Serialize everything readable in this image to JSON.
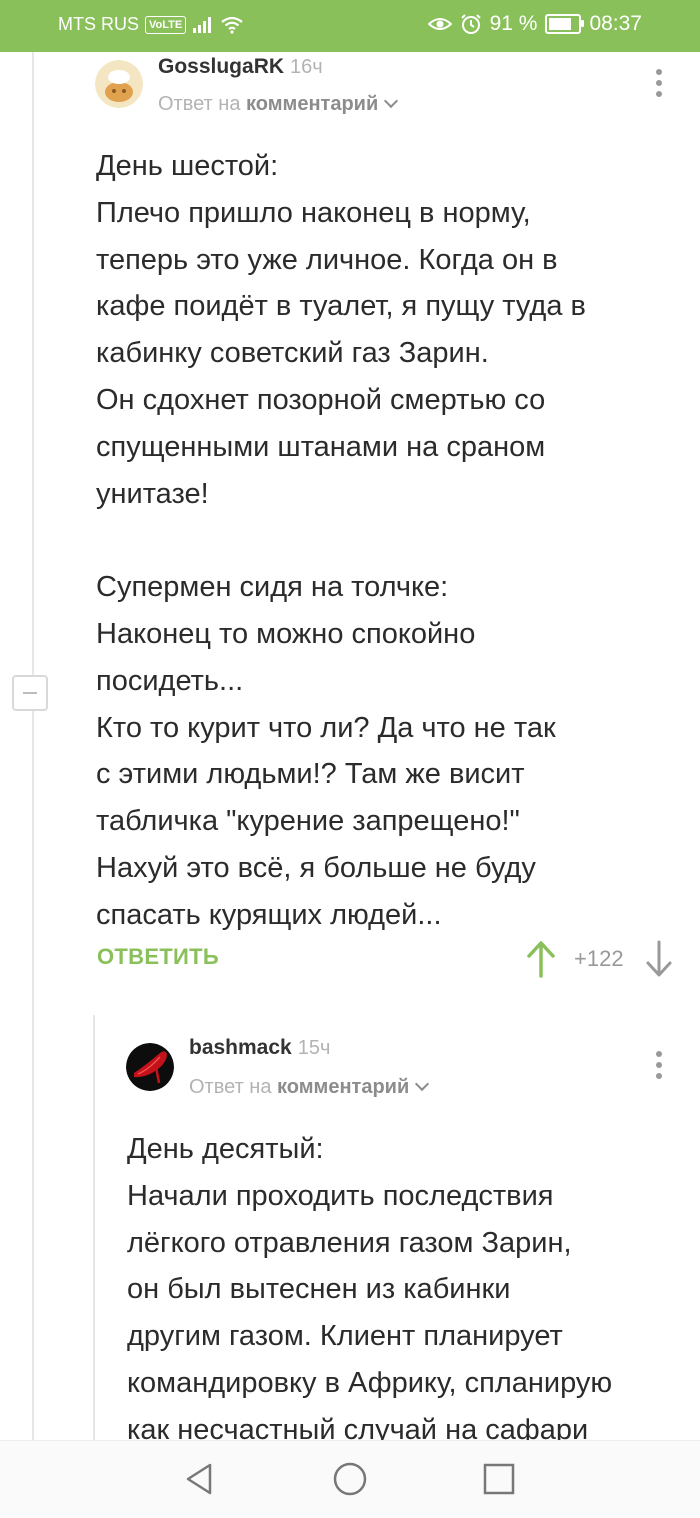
{
  "status_bar": {
    "carrier": "MTS RUS",
    "volte": "VoLTE",
    "battery_percent": "91 %",
    "battery_level": 0.91,
    "time": "08:37"
  },
  "comments": [
    {
      "author": "GosslugaRK",
      "time": "16ч",
      "reply_prefix": "Ответ на",
      "reply_target": "комментарий",
      "lines": [
        "День шестой:",
        "Плечо пришло наконец в норму,",
        "теперь это уже личное. Когда он в",
        "кафе поидёт в туалет, я пущу туда в",
        "кабинку советский газ Зарин.",
        "Он сдохнет позорной смертью со",
        "спущенными штанами на сраном",
        "унитазе!",
        "",
        "Супермен сидя на толчке:",
        "Наконец то можно спокойно",
        "посидеть...",
        "Кто то курит что ли? Да что не так",
        "с этими людьми!? Там же висит",
        "табличка \"курение запрещено!\"",
        "Нахуй это всё, я больше не буду",
        "спасать курящих людей..."
      ],
      "reply_label": "ОТВЕТИТЬ",
      "rating": "+122"
    },
    {
      "author": "bashmack",
      "time": "15ч",
      "reply_prefix": "Ответ на",
      "reply_target": "комментарий",
      "lines": [
        "День десятый:",
        "Начали проходить последствия",
        "лёгкого отравления газом Зарин,",
        "он был вытеснен из кабинки",
        "другим газом. Клиент планирует",
        "командировку в Африку, спланирую",
        "как несчастный случай на сафари"
      ]
    }
  ],
  "colors": {
    "accent": "#8ac05a",
    "muted": "#b3b3b3"
  },
  "icons": [
    "eye-icon",
    "alarm-icon",
    "signal-icon",
    "wifi-icon",
    "battery-icon",
    "more-vert-icon",
    "arrow-up-icon",
    "arrow-down-icon",
    "collapse-icon",
    "back-icon",
    "home-icon",
    "recents-icon"
  ]
}
